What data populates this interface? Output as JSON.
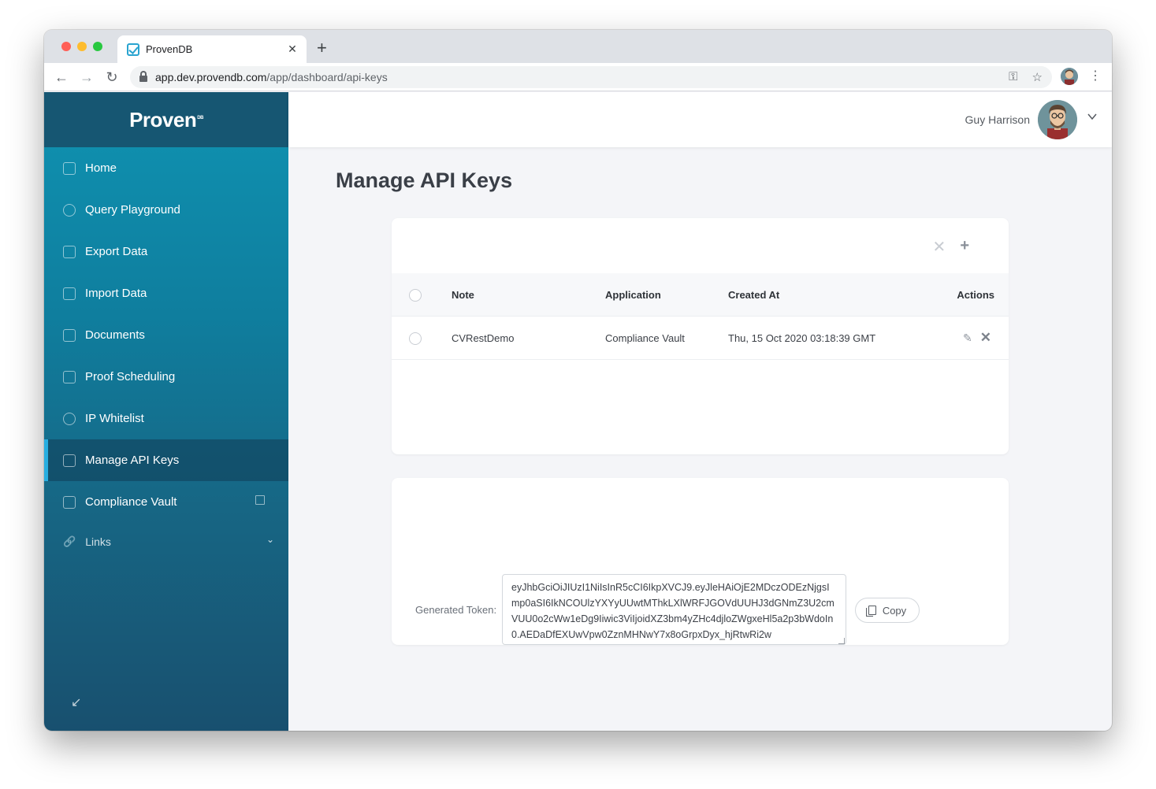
{
  "browser": {
    "tab_title": "ProvenDB",
    "tab_close": "✕",
    "new_tab": "+",
    "url_host": "app.dev.provendb.com",
    "url_path": "/app/dashboard/api-keys",
    "traffic_lights": [
      "#ff5f57",
      "#febc2e",
      "#28c840"
    ]
  },
  "brand": {
    "logo_text": "Proven",
    "logo_suffix": "DB"
  },
  "sidebar": {
    "items": [
      {
        "label": "Home",
        "icon": "home-icon"
      },
      {
        "label": "Query Playground",
        "icon": "play-circle-icon"
      },
      {
        "label": "Export Data",
        "icon": "export-icon"
      },
      {
        "label": "Import Data",
        "icon": "import-icon"
      },
      {
        "label": "Documents",
        "icon": "documents-icon"
      },
      {
        "label": "Proof Scheduling",
        "icon": "calendar-icon"
      },
      {
        "label": "IP Whitelist",
        "icon": "location-pin-icon"
      },
      {
        "label": "Manage API Keys",
        "icon": "key-icon",
        "active": true
      },
      {
        "label": "Compliance Vault",
        "icon": "vault-icon",
        "external": true
      }
    ],
    "links_label": "Links"
  },
  "header": {
    "user_name": "Guy Harrison"
  },
  "main": {
    "page_title": "Manage API Keys",
    "table": {
      "columns": [
        "Note",
        "Application",
        "Created At",
        "Actions"
      ],
      "rows": [
        {
          "note": "CVRestDemo",
          "application": "Compliance Vault",
          "created_at": "Thu, 15 Oct 2020 03:18:39 GMT"
        }
      ]
    },
    "token": {
      "label": "Generated Token:",
      "value": "eyJhbGciOiJIUzI1NiIsInR5cCI6IkpXVCJ9.eyJleHAiOjE2MDczODEzNjgsImp0aSI6IkNCOUlzYXYyUUwtMThkLXlWRFJGOVdUUHJ3dGNmZ3U2cmVUU0o2cWw1eDg9Iiwic3ViIjoidXZ3bm4yZHc4djloZWgxeHl5a2p3bWdoIn0.AEDaDfEXUwVpw0ZznMHNwY7x8oGrpxDyx_hjRtwRi2w",
      "copy_label": "Copy"
    }
  },
  "colors": {
    "sidebar_top": "#0f93b2",
    "sidebar_bottom": "#18506f",
    "accent": "#27aee0"
  }
}
